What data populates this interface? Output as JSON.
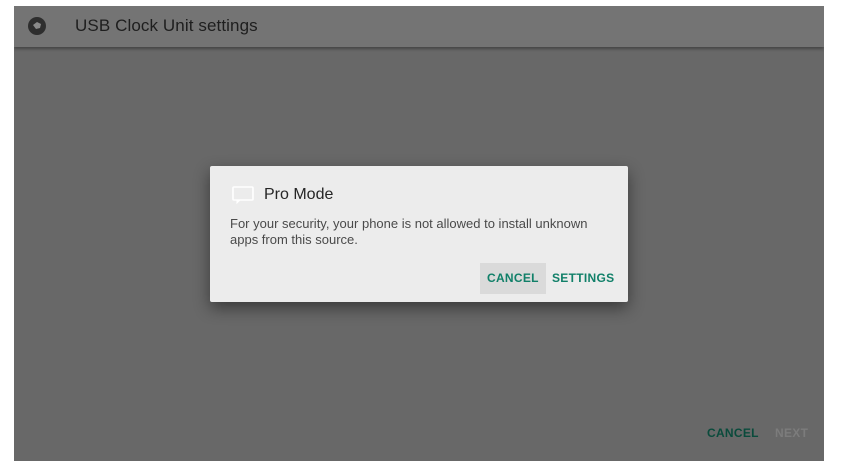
{
  "app": {
    "title": "USB Clock Unit settings",
    "icon": "app-logo-icon"
  },
  "footer": {
    "cancel_label": "CANCEL",
    "next_label": "NEXT"
  },
  "dialog": {
    "icon": "message-icon",
    "title": "Pro Mode",
    "message": "For your security, your phone is not allowed to install unknown apps from this source.",
    "cancel_label": "CANCEL",
    "settings_label": "SETTINGS"
  },
  "colors": {
    "accent": "#118069",
    "scrim": "#686868",
    "dialog_bg": "#ececec"
  }
}
